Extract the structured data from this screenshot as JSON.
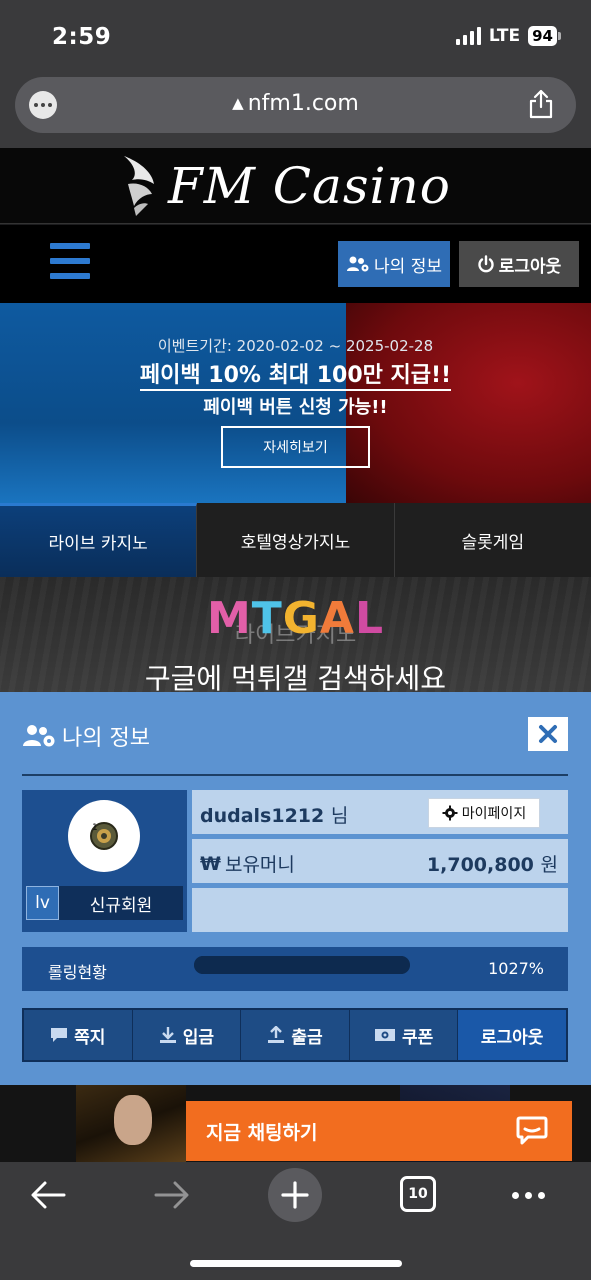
{
  "status_bar": {
    "time": "2:59",
    "network": "LTE",
    "battery": "94"
  },
  "browser": {
    "url": "nfm1.com",
    "open_tabs": "10"
  },
  "site": {
    "logo_text": "FM Casino",
    "my_info_button": "나의 정보",
    "logout_button": "로그아웃"
  },
  "banner": {
    "event_period": "이벤트기간: 2020-02-02 ~ 2025-02-28",
    "headline": "페이백 10% 최대 100만 지급!!",
    "subline": "페이백 버튼 신청 가능!!",
    "detail_button": "자세히보기"
  },
  "tabs": [
    {
      "label": "라이브 카지노",
      "active": true
    },
    {
      "label": "호텔영상가지노",
      "active": false
    },
    {
      "label": "슬롯게임",
      "active": false
    }
  ],
  "promo": {
    "logo": {
      "m": "M",
      "t": "T",
      "g": "G",
      "a": "A",
      "l": "L"
    },
    "ghost_text": "라이브카지노",
    "text": "구글에 먹튀갤 검색하세요"
  },
  "panel": {
    "title": "나의 정보",
    "level_badge": "lv",
    "grade": "신규회원",
    "username": "dudals1212",
    "username_suffix": "님",
    "mypage_button": "마이페이지",
    "money_label": "보유머니",
    "money_value": "1,700,800",
    "money_unit": "원",
    "rolling_label": "롤링현황",
    "rolling_value": "1027%",
    "rolling_fraction": 1.0,
    "actions": [
      "쪽지",
      "입금",
      "출금",
      "쿠폰",
      "로그아웃"
    ]
  },
  "chat": {
    "label": "지금 채팅하기"
  },
  "colors": {
    "accent_blue": "#2f6db5",
    "panel_bg": "#5c93d1",
    "chat_orange": "#f26d1f"
  },
  "icons": {
    "warning": "warning-icon",
    "share": "share-icon",
    "users": "users-gear-icon",
    "power": "power-icon",
    "close": "close-icon",
    "gear": "gear-icon",
    "won": "won-icon",
    "message": "message-icon",
    "download": "download-icon",
    "upload": "upload-icon",
    "coupon": "coupon-icon",
    "chat": "chat-bubble-icon"
  }
}
